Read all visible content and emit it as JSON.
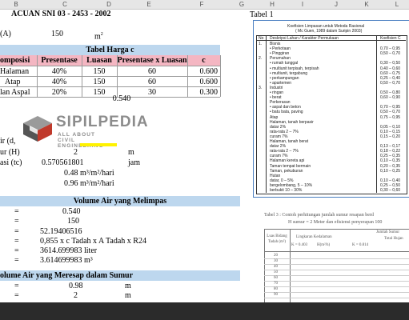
{
  "header": {
    "title": "ACUAN SNI 03 - 2453 - 2002",
    "area_label": "(A)",
    "area_value": "150",
    "area_unit": "m",
    "area_sup": "2",
    "col_letters": [
      "B",
      "C",
      "D",
      "E",
      "F",
      "G",
      "H",
      "I",
      "J",
      "K",
      "L"
    ]
  },
  "tabel_harga": {
    "title": "Tabel Harga c",
    "headers": [
      "omposisi",
      "Presentase",
      "Luasan",
      "Presentase x Luasan",
      "c"
    ],
    "rows": [
      [
        "Halaman",
        "40%",
        "150",
        "60",
        "0.600"
      ],
      [
        "Atap",
        "40%",
        "150",
        "60",
        "0.600"
      ],
      [
        "lan Aspal",
        "20%",
        "150",
        "30",
        "0.300"
      ]
    ],
    "total": "0.540"
  },
  "calc": {
    "r1_label": "ir (d,",
    "r2_label": "ur (H)",
    "r2_value": "2",
    "r2_unit": "m",
    "r3_label": "asi (tc)",
    "r3_value": "0.570561801",
    "r3_unit": "jam",
    "r4_value": "0.48",
    "r4_unit": "m³/m²/hari",
    "r5_value": "0.96",
    "r5_unit": "m³/m²/hari"
  },
  "volume_melimpas": {
    "title": "Volume Air yang Melimpas",
    "rows": [
      [
        "=",
        "0.540",
        ""
      ],
      [
        "=",
        "150",
        ""
      ],
      [
        "=",
        "52.19406516",
        ""
      ],
      [
        "=",
        "0,855 x c Tadah x A Tadah x R24",
        ""
      ],
      [
        "=",
        "3614.699983",
        "liter"
      ],
      [
        "=",
        "3.614699983",
        "m³"
      ]
    ]
  },
  "volume_meresap": {
    "title": "olume Air yang Meresap dalam Sumur",
    "rows": [
      [
        "=",
        "0.98",
        "m"
      ],
      [
        "=",
        "2",
        "m"
      ]
    ]
  },
  "watermark": {
    "title": "SIPILPEDIA",
    "subtitle": "ALL ABOUT CIVIL ENGINEERING"
  },
  "tabel1": {
    "label": "Tabel 1",
    "doc_title": "Koefisien Limpasan untuk Metoda Rasional",
    "doc_subtitle": "( Mc Guen, 1989 dalam Suripin 2003)",
    "headers": [
      "No",
      "Deskripsi Lahan / Karakter Permukaan",
      "Koefisien C"
    ],
    "rows": [
      [
        "1.",
        "Bisnis",
        ""
      ],
      [
        "",
        "• Perkotaan",
        "0,70 – 0,95"
      ],
      [
        "",
        "• Pinggiran",
        "0,50 – 0,70"
      ],
      [
        "2.",
        "Perumahan",
        ""
      ],
      [
        "",
        "• rumah tunggal",
        "0,30 – 0,50"
      ],
      [
        "",
        "• multiunit terpisah, terpisah",
        "0,40 – 0,60"
      ],
      [
        "",
        "• multiunit, tergabung",
        "0,60 – 0,75"
      ],
      [
        "",
        "• perkampungan",
        "0,25 – 0,40"
      ],
      [
        "",
        "• apartemen",
        "0,50 – 0,70"
      ],
      [
        "3.",
        "Industri",
        ""
      ],
      [
        "",
        "• ringan",
        "0,50 – 0,80"
      ],
      [
        "",
        "• berat",
        "0,60 – 0,90"
      ],
      [
        "",
        "Perkerasan",
        ""
      ],
      [
        "",
        "• aspal dan beton",
        "0,70 – 0,95"
      ],
      [
        "",
        "• batu bata, paving",
        "0,50 – 0,70"
      ],
      [
        "",
        "Atap",
        "0,75 – 0,95"
      ],
      [
        "",
        "Halaman, tanah berpasir",
        ""
      ],
      [
        "",
        "datar 2%",
        "0,05 – 0,10"
      ],
      [
        "",
        "rata-rata 2 – 7%",
        "0,10 – 0,15"
      ],
      [
        "",
        "curam 7%",
        "0,15 – 0,20"
      ],
      [
        "",
        "Halaman, tanah berat",
        ""
      ],
      [
        "",
        "datar 2%",
        "0,13 – 0,17"
      ],
      [
        "",
        "rata-rata 2 – 7%",
        "0,18 – 0,22"
      ],
      [
        "",
        "curam 7%",
        "0,25 – 0,35"
      ],
      [
        "",
        "Halaman kereta api",
        "0,10 – 0,35"
      ],
      [
        "",
        "Taman tempat bermain",
        "0,20 – 0,35"
      ],
      [
        "",
        "Taman, pekuburan",
        "0,10 – 0,25"
      ],
      [
        "",
        "Hutan",
        ""
      ],
      [
        "",
        "datar, 0 – 5%",
        "0,10 – 0,40"
      ],
      [
        "",
        "bergelombang, 5 – 10%",
        "0,25 – 0,50"
      ],
      [
        "",
        "berbukit 10 – 30%",
        "0,30 – 0,60"
      ]
    ]
  },
  "tabel3": {
    "caption": "Tabel 3 : Contoh perhitungan jumlah sumur resapan berd",
    "caption2": "H sumur = 2 Meter dan efisiensi penyerapan 100",
    "col_headers": [
      "Luas Bidang Tadah (m²)",
      "Lingkaran Kedalaman",
      "Jumlah Sumur"
    ],
    "sub_headers": [
      "K = 0.403",
      "H(m²/h)",
      "K = 0.814",
      "Total Hujan"
    ],
    "rows": [
      "20",
      "30",
      "40",
      "50",
      "60",
      "70",
      "80",
      "90"
    ]
  }
}
